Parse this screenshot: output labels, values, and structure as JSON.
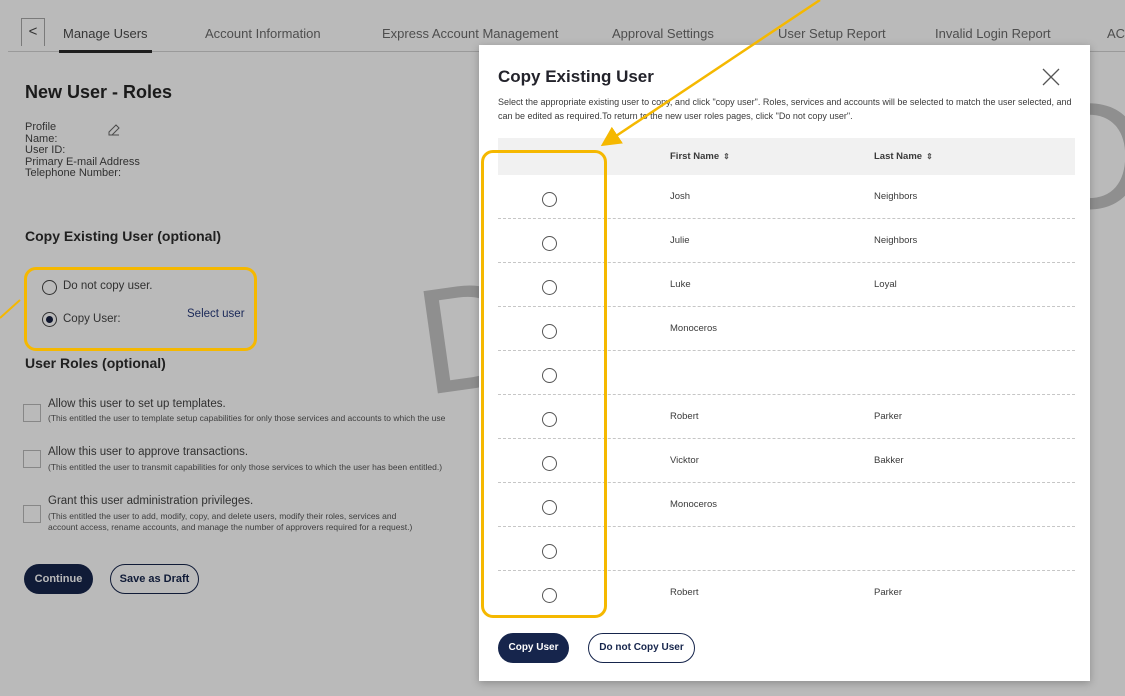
{
  "tabs": {
    "back_symbol": "<",
    "items": [
      {
        "label": "Manage Users",
        "active": true
      },
      {
        "label": "Account Information"
      },
      {
        "label": "Express Account Management"
      },
      {
        "label": "Approval Settings"
      },
      {
        "label": "User Setup Report"
      },
      {
        "label": "Invalid Login Report"
      },
      {
        "label": "AC"
      }
    ]
  },
  "page": {
    "title": "New User - Roles",
    "profile_fields": [
      "Profile",
      "Name:",
      "User ID:",
      "Primary E-mail Address",
      "Telephone Number:"
    ],
    "copy_section_title": "Copy Existing User (optional)",
    "do_not_copy_label": "Do not copy user.",
    "copy_user_label": "Copy User:",
    "select_user_link": "Select user",
    "roles_section_title": "User Roles (optional)",
    "roles": [
      {
        "title": "Allow this user to set up templates.",
        "desc": "(This entitled the user to template setup capabilities for only those services and accounts to which the use"
      },
      {
        "title": "Allow this user to approve transactions.",
        "desc": "(This entitled the user to transmit capabilities for only those services to which the user has been entitled.)"
      },
      {
        "title": "Grant this user administration privileges.",
        "desc_line1": "(This entitled the user to add, modify, copy, and delete users, modify their roles, services and",
        "desc_line2": "account access, rename accounts, and manage the number of approvers required for a request.)"
      }
    ],
    "continue_label": "Continue",
    "save_draft_label": "Save as Draft",
    "watermark_d": "D",
    "watermark_o": "O"
  },
  "modal": {
    "title": "Copy Existing User",
    "close_symbol": "×",
    "description": "Select the appropriate existing user to copy, and click \"copy user\". Roles, services and accounts will be selected to match the user selected, and can be edited as required.To return to the new user roles pages, click \"Do not copy user\".",
    "columns": {
      "first": "First Name",
      "last": "Last Name",
      "sort_symbol": "⇕"
    },
    "rows": [
      {
        "first": "Josh",
        "last": "Neighbors"
      },
      {
        "first": "Julie",
        "last": "Neighbors"
      },
      {
        "first": "Luke",
        "last": "Loyal"
      },
      {
        "first": "Monoceros",
        "last": ""
      },
      {
        "first": "",
        "last": ""
      },
      {
        "first": "Robert",
        "last": "Parker"
      },
      {
        "first": "Vicktor",
        "last": "Bakker"
      },
      {
        "first": "Monoceros",
        "last": ""
      },
      {
        "first": "",
        "last": ""
      },
      {
        "first": "Robert",
        "last": "Parker"
      }
    ],
    "copy_user_button": "Copy User",
    "do_not_copy_button": "Do not Copy User"
  },
  "colors": {
    "highlight": "#f5b800",
    "primary_dark": "#16254c",
    "link": "#273a7b"
  }
}
